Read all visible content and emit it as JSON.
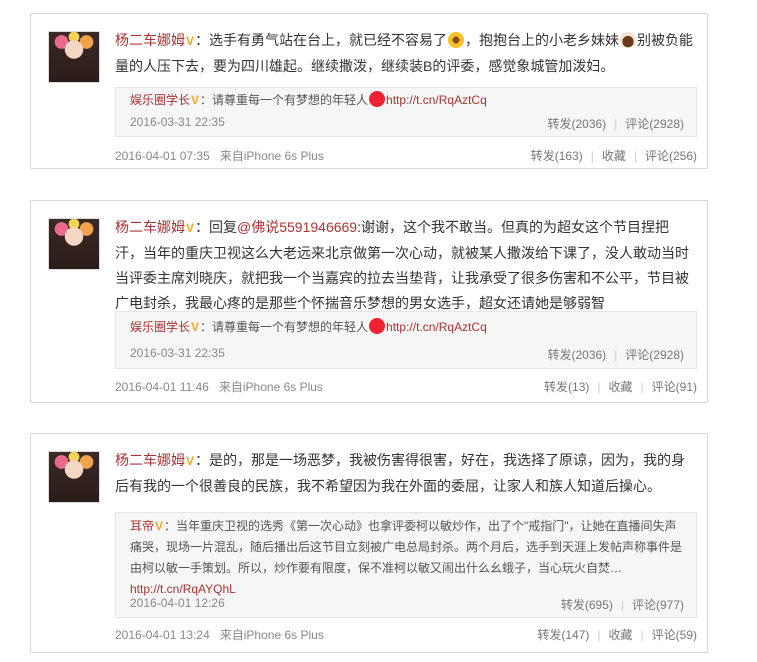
{
  "posts": [
    {
      "author": "杨二车娜姆",
      "badge": "V",
      "colon": "：",
      "text_a": "选手有勇气站在台上，就已经不容易了",
      "text_b": "，抱抱台上的小老乡妹妹",
      "text_c": "别被负能量的人压下去，要为四川雄起。继续撒泼，继续装B的评委，感觉象城管加泼妇。",
      "quote": {
        "author": "娱乐圈学长",
        "badge": "V",
        "text": "：请尊重每一个有梦想的年轻人",
        "link": "http://t.cn/RqAztCq",
        "time": "2016-03-31 22:35",
        "repost": "转发(2036)",
        "comment": "评论(2928)"
      },
      "time": "2016-04-01 07:35",
      "source": "来自iPhone 6s Plus",
      "repost": "转发(163)",
      "fav": "收藏",
      "comment": "评论(256)"
    },
    {
      "author": "杨二车娜姆",
      "badge": "V",
      "colon": "：",
      "reply_prefix": "回复",
      "mention": "@佛说5591946669",
      "text": ":谢谢，这个我不敢当。但真的为超女这个节目捏把汗，当年的重庆卫视这么大老远来北京做第一次心动，就被某人撒泼给下课了，没人敢动当时当评委主席刘晓庆，就把我一个当嘉宾的拉去当垫背，让我承受了很多伤害和不公平，节目被广电封杀，我最心疼的是那些个怀揣音乐梦想的男女选手，超女还请她是够弱智",
      "quote": {
        "author": "娱乐圈学长",
        "badge": "V",
        "text": "：请尊重每一个有梦想的年轻人",
        "link": "http://t.cn/RqAztCq",
        "time": "2016-03-31 22:35",
        "repost": "转发(2036)",
        "comment": "评论(2928)"
      },
      "time": "2016-04-01 11:46",
      "source": "来自iPhone 6s Plus",
      "repost": "转发(13)",
      "fav": "收藏",
      "comment": "评论(91)"
    },
    {
      "author": "杨二车娜姆",
      "badge": "V",
      "colon": "：",
      "text": "是的，那是一场恶梦，我被伤害得很害，好在，我选择了原谅，因为，我的身后有我的一个很善良的民族，我不希望因为我在外面的委屈，让家人和族人知道后操心。",
      "quote": {
        "author": "耳帝",
        "badge": "V",
        "text": "：当年重庆卫视的选秀《第一次心动》也拿评委柯以敏炒作，出了个\"戒指门\"，让她在直播间失声痛哭，现场一片混乱，随后播出后这节目立刻被广电总局封杀。两个月后，选手到天涯上发帖声称事件是由柯以敏一手策划。所以，炒作要有限度，保不准柯以敏又闹出什么幺蛾子，当心玩火自焚…",
        "link": "http://t.cn/RqAYQhL",
        "time": "2016-04-01 12:26",
        "repost": "转发(695)",
        "comment": "评论(977)"
      },
      "time": "2016-04-01 13:24",
      "source": "来自iPhone 6s Plus",
      "repost": "转发(147)",
      "fav": "收藏",
      "comment": "评论(59)"
    }
  ]
}
